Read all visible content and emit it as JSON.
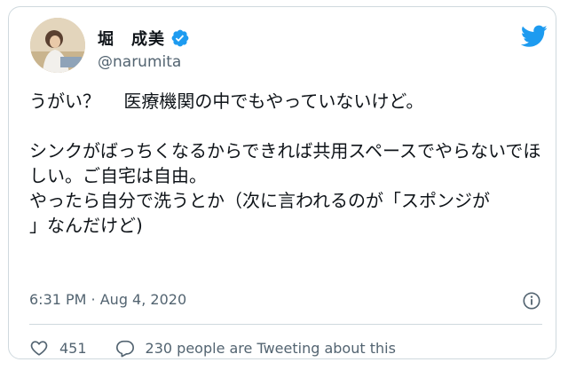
{
  "author": {
    "name": "堀　成美",
    "handle": "@narumita"
  },
  "tweet": {
    "text": "うがい？　 医療機関の中でもやっていないけど。\n\nシンクがばっちくなるからできれば共用スペースでやらないでほしい。ご自宅は自由。\nやったら自分で洗うとか（次に言われるのが「スポンジが\n」なんだけど)",
    "timestamp": "6:31 PM · Aug 4, 2020"
  },
  "actions": {
    "likes": "451",
    "conversation": "230 people are Tweeting about this"
  },
  "icons": {
    "verified": "verified-badge-icon",
    "logo": "twitter-bird-icon",
    "info": "info-icon",
    "like": "heart-icon",
    "reply": "reply-bubble-icon"
  },
  "colors": {
    "brand": "#1d9bf0",
    "text": "#0f1419",
    "secondary": "#536471"
  }
}
